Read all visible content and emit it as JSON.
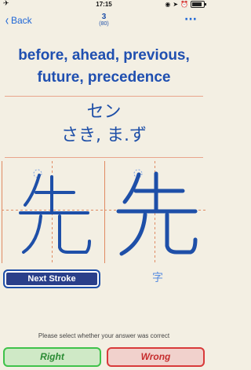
{
  "status_bar": {
    "time": "17:15",
    "battery_level": 0.85
  },
  "nav": {
    "back_label": "Back",
    "card_number": "3",
    "card_total": "(80)",
    "more_label": "···"
  },
  "card": {
    "meaning_line1": "before, ahead, previous,",
    "meaning_line2": "future, precedence",
    "onyomi": "セン",
    "kunyomi": "さき, ま.ず",
    "kanji": "先"
  },
  "controls": {
    "next_stroke_label": "Next Stroke",
    "character_label": "字",
    "prompt": "Please select whether your answer was correct",
    "right_label": "Right",
    "wrong_label": "Wrong"
  },
  "colors": {
    "accent_blue": "#1e4fa8",
    "guide_orange": "#e08a62",
    "right_green": "#3fc24a",
    "wrong_red": "#d83a3a"
  }
}
